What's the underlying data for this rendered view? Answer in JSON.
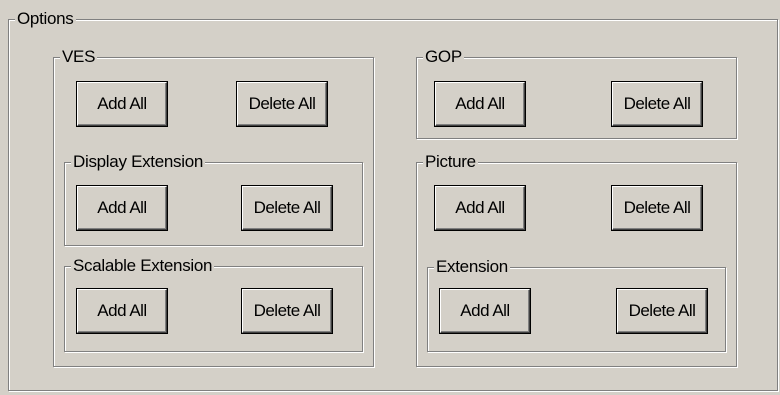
{
  "options": {
    "title": "Options",
    "ves": {
      "title": "VES",
      "add_all": "Add All",
      "delete_all": "Delete All",
      "display_extension": {
        "title": "Display Extension",
        "add_all": "Add All",
        "delete_all": "Delete All"
      },
      "scalable_extension": {
        "title": "Scalable Extension",
        "add_all": "Add All",
        "delete_all": "Delete All"
      }
    },
    "gop": {
      "title": "GOP",
      "add_all": "Add All",
      "delete_all": "Delete All"
    },
    "picture": {
      "title": "Picture",
      "add_all": "Add All",
      "delete_all": "Delete All",
      "extension": {
        "title": "Extension",
        "add_all": "Add All",
        "delete_all": "Delete All"
      }
    }
  }
}
